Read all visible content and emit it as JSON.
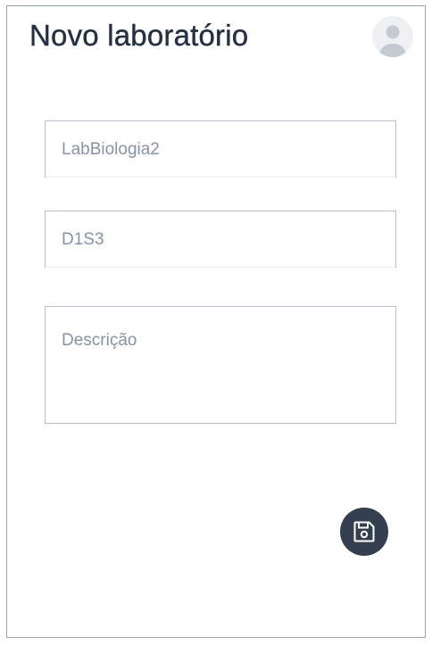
{
  "header": {
    "title": "Novo laboratório",
    "avatar_icon": "user-avatar-icon"
  },
  "form": {
    "name_field": {
      "value": "",
      "placeholder": "LabBiologia2"
    },
    "code_field": {
      "value": "",
      "placeholder": "D1S3"
    },
    "description_field": {
      "value": "",
      "placeholder": "Descrição"
    }
  },
  "actions": {
    "save_icon": "floppy-disk-icon"
  },
  "colors": {
    "title": "#253142",
    "placeholder": "#8892a6",
    "border": "#b9bfca",
    "frame": "#9aa4b5",
    "save_button_bg": "#34404f",
    "avatar_bg": "#eef0f4",
    "avatar_fg": "#c4c9d2"
  }
}
